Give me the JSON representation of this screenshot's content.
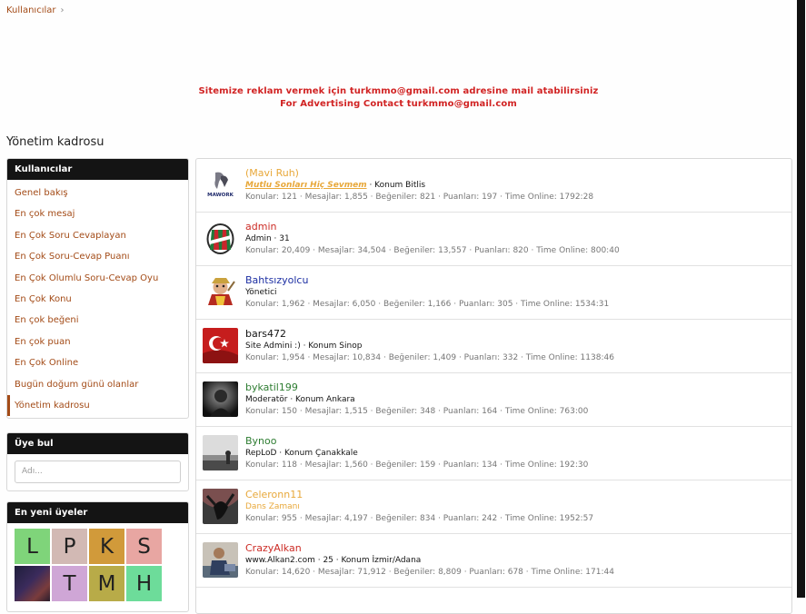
{
  "breadcrumb": {
    "label": "Kullanıcılar",
    "chevron": "›"
  },
  "ad": {
    "line1": "Sitemize reklam vermek için turkmmo@gmail.com adresine mail atabilirsiniz",
    "line2": "For Advertising Contact turkmmo@gmail.com"
  },
  "page_title": "Yönetim kadrosu",
  "sidebar": {
    "header": "Kullanıcılar",
    "items": [
      {
        "label": "Genel bakış"
      },
      {
        "label": "En çok mesaj"
      },
      {
        "label": "En Çok Soru Cevaplayan"
      },
      {
        "label": "En Çok Soru-Cevap Puanı"
      },
      {
        "label": "En Çok Olumlu Soru-Cevap Oyu"
      },
      {
        "label": "En Çok Konu"
      },
      {
        "label": "En çok beğeni"
      },
      {
        "label": "En çok puan"
      },
      {
        "label": "En Çok Online"
      },
      {
        "label": "Bugün doğum günü olanlar"
      },
      {
        "label": "Yönetim kadrosu",
        "active": true
      }
    ]
  },
  "member_search": {
    "header": "Üye bul",
    "placeholder": "Adı..."
  },
  "newest": {
    "header": "En yeni üyeler",
    "tiles": [
      {
        "letter": "L",
        "color": "#7fd47a"
      },
      {
        "letter": "P",
        "color": "#d2b9b4"
      },
      {
        "letter": "K",
        "color": "#d19a3a"
      },
      {
        "letter": "S",
        "color": "#e8a6a2"
      },
      {
        "letter": "",
        "image": true,
        "color": "#2a2040"
      },
      {
        "letter": "T",
        "color": "#cfa6d6"
      },
      {
        "letter": "M",
        "color": "#b8ab48"
      },
      {
        "letter": "H",
        "color": "#6ddc9a"
      }
    ]
  },
  "staff": [
    {
      "name": "(Mavi Ruh)",
      "name_color": "#e8a83a",
      "special_title": "Mutlu Sonları Hiç Sevmem",
      "title": " · Konum Bitlis",
      "stats": "Konular: 121 · Mesajlar: 1,855 · Beğeniler: 821 · Puanları: 197 · Time Online: 1792:28",
      "avatar": "mawork-logo"
    },
    {
      "name": "admin",
      "name_color": "#cc2b25",
      "title": "Admin · 31",
      "stats": "Konular: 20,409 · Mesajlar: 34,504 · Beğeniler: 13,557 · Puanları: 820 · Time Online: 800:40",
      "avatar": "jersey"
    },
    {
      "name": "Bahtsızyolcu",
      "name_color": "#1d2fa3",
      "title": "Yönetici",
      "stats": "Konular: 1,962 · Mesajlar: 6,050 · Beğeniler: 1,166 · Puanları: 305 · Time Online: 1534:31",
      "avatar": "character"
    },
    {
      "name": "bars472",
      "name_color": "#141414",
      "title": "Site Admini :) · Konum Sinop",
      "stats": "Konular: 1,954 · Mesajlar: 10,834 · Beğeniler: 1,409 · Puanları: 332 · Time Online: 1138:46",
      "avatar": "flag"
    },
    {
      "name": "bykatil199",
      "name_color": "#2e7d32",
      "title": "Moderatör · Konum Ankara",
      "stats": "Konular: 150 · Mesajlar: 1,515 · Beğeniler: 348 · Puanları: 164 · Time Online: 763:00",
      "avatar": "dark-photo"
    },
    {
      "name": "Bynoo",
      "name_color": "#2e7d32",
      "title": "RepLoD · Konum Çanakkale",
      "stats": "Konular: 118 · Mesajlar: 1,560 · Beğeniler: 159 · Puanları: 134 · Time Online: 192:30",
      "avatar": "beach-photo"
    },
    {
      "name": "Celeronn11",
      "name_color": "#e8a83a",
      "title_gold": "Dans Zamanı",
      "stats": "Konular: 955 · Mesajlar: 4,197 · Beğeniler: 834 · Puanları: 242 · Time Online: 1952:57",
      "avatar": "dancer"
    },
    {
      "name": "CrazyAlkan",
      "name_color": "#cc2b25",
      "title": "www.Alkan2.com · 25 · Konum İzmir/Adana",
      "stats": "Konular: 14,620 · Mesajlar: 71,912 · Beğeniler: 8,809 · Puanları: 678 · Time Online: 171:44",
      "avatar": "person-photo"
    }
  ]
}
